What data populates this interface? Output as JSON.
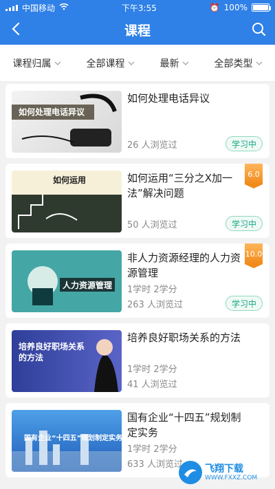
{
  "status_bar": {
    "carrier": "中国移动",
    "time": "下午3:55",
    "battery": "100%"
  },
  "nav": {
    "title": "课程"
  },
  "filters": [
    {
      "label": "课程归属"
    },
    {
      "label": "全部课程"
    },
    {
      "label": "最新"
    },
    {
      "label": "全部类型"
    }
  ],
  "courses": [
    {
      "title": "如何处理电话异议",
      "stats": "",
      "views": "26 人浏览过",
      "status": "学习中",
      "price": "",
      "thumb_text": "如何处理电话异议"
    },
    {
      "title": "如何运用“三分之X加一法”解决问题",
      "stats": "",
      "views": "50 人浏览过",
      "status": "学习中",
      "price": "6.0",
      "thumb_text": "如何运用"
    },
    {
      "title": "非人力资源经理的人力资源管理",
      "stats": "1学时  2学分",
      "views": "263 人浏览过",
      "status": "学习中",
      "price": "10.0",
      "thumb_text": "人力资源管理"
    },
    {
      "title": "培养良好职场关系的方法",
      "stats": "1学时  2学分",
      "views": "41 人浏览过",
      "status": "",
      "price": "",
      "thumb_text": "培养良好职场关系的方法"
    },
    {
      "title": "国有企业“十四五”规划制定实务",
      "stats": "1学时  2学分",
      "views": "633 人浏览过",
      "status": "",
      "price": "",
      "thumb_text": "国有企业“十四五”规划制定实务"
    }
  ],
  "watermark": {
    "brand": "飞翔下载",
    "url": "WWW.FXXZ.COM"
  }
}
